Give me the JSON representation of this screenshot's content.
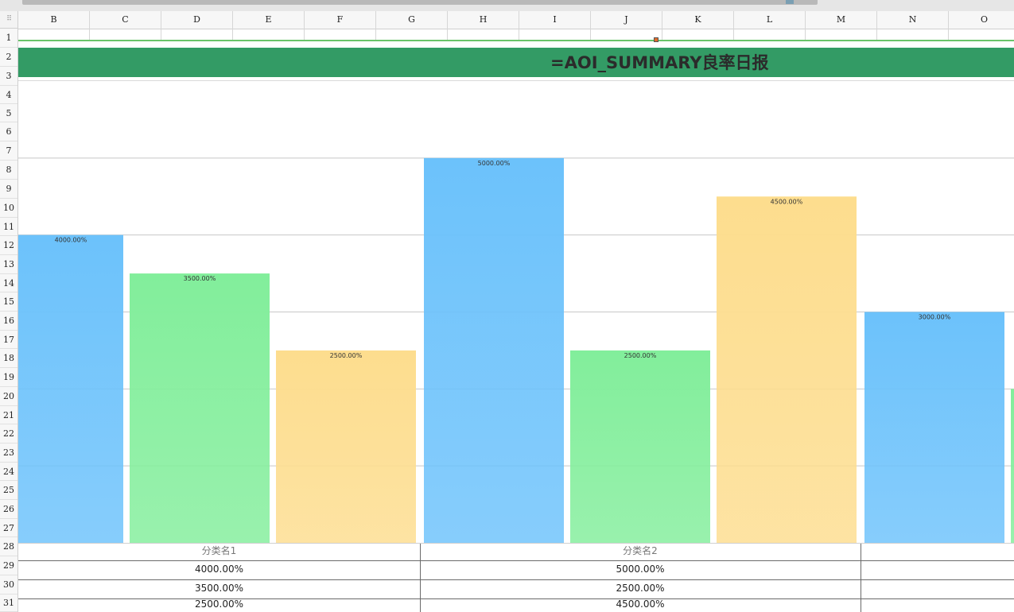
{
  "spreadsheet": {
    "columns": [
      "B",
      "C",
      "D",
      "E",
      "F",
      "G",
      "H",
      "I",
      "J",
      "K",
      "L",
      "M",
      "N",
      "O"
    ],
    "rows": [
      "1",
      "2",
      "3",
      "4",
      "5",
      "6",
      "7",
      "8",
      "9",
      "10",
      "11",
      "12",
      "13",
      "14",
      "15",
      "16",
      "17",
      "18",
      "19",
      "20",
      "21",
      "22",
      "23",
      "24",
      "25",
      "26",
      "27",
      "28",
      "29",
      "30",
      "31"
    ],
    "title": "=AOI_SUMMARY良率日报",
    "title_band_color": "#339b65"
  },
  "chart_data": {
    "type": "bar",
    "categories": [
      "分类名1",
      "分类名2",
      ""
    ],
    "series": [
      {
        "values": [
          4000,
          5000,
          3000
        ],
        "color": "#6cc2fb"
      },
      {
        "values": [
          3500,
          2500,
          2000
        ],
        "color": "#82ee9b"
      },
      {
        "values": [
          2500,
          4500,
          null
        ],
        "color": "#fddd8e"
      }
    ],
    "value_labels": [
      [
        "4000.00%",
        "5000.00%",
        "3000.00%"
      ],
      [
        "3500.00%",
        "2500.00%",
        ""
      ],
      [
        "2500.00%",
        "4500.00%",
        ""
      ]
    ],
    "unit": "%",
    "ylim": [
      0,
      6000
    ],
    "grid": true
  },
  "data_table": {
    "header": [
      "分类名1",
      "分类名2",
      ""
    ],
    "rows": [
      [
        "4000.00%",
        "5000.00%",
        ""
      ],
      [
        "3500.00%",
        "2500.00%",
        ""
      ],
      [
        "2500.00%",
        "4500.00%",
        ""
      ]
    ]
  }
}
